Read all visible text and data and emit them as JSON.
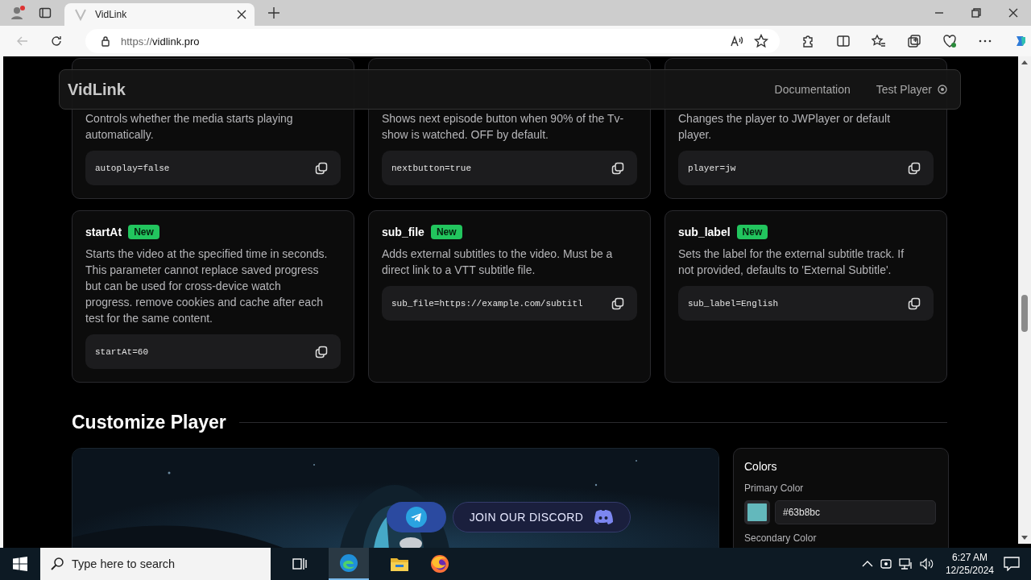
{
  "browser": {
    "tab_title": "VidLink",
    "url_scheme": "https://",
    "url_host": "vidlink.pro"
  },
  "header": {
    "logo": "VidLink",
    "nav": [
      {
        "label": "Documentation"
      },
      {
        "label": "Test Player"
      }
    ]
  },
  "param_rows": [
    [
      {
        "description": "Controls whether the media starts playing automatically.",
        "code": "autoplay=false"
      },
      {
        "description": "Shows next episode button when 90% of the Tv-show is watched. OFF by default.",
        "code": "nextbutton=true"
      },
      {
        "description": "Changes the player to JWPlayer or default player.",
        "code": "player=jw"
      }
    ],
    [
      {
        "name": "startAt",
        "badge": "New",
        "description": "Starts the video at the specified time in seconds. This parameter cannot replace saved progress but can be used for cross-device watch progress. remove cookies and cache after each test for the same content.",
        "code": "startAt=60"
      },
      {
        "name": "sub_file",
        "badge": "New",
        "description": "Adds external subtitles to the video. Must be a direct link to a VTT subtitle file.",
        "code": "sub_file=https://example.com/subtitl"
      },
      {
        "name": "sub_label",
        "badge": "New",
        "description": "Sets the label for the external subtitle track. If not provided, defaults to 'External Subtitle'.",
        "code": "sub_label=English"
      }
    ]
  ],
  "customize": {
    "title": "Customize Player",
    "colors": {
      "title": "Colors",
      "fields": [
        {
          "label": "Primary Color",
          "value": "#63b8bc",
          "color": "#63b8bc"
        },
        {
          "label": "Secondary Color"
        }
      ]
    }
  },
  "social": {
    "discord_label": "JOIN OUR DISCORD"
  },
  "taskbar": {
    "search_placeholder": "Type here to search",
    "time": "6:27 AM",
    "date": "12/25/2024"
  }
}
